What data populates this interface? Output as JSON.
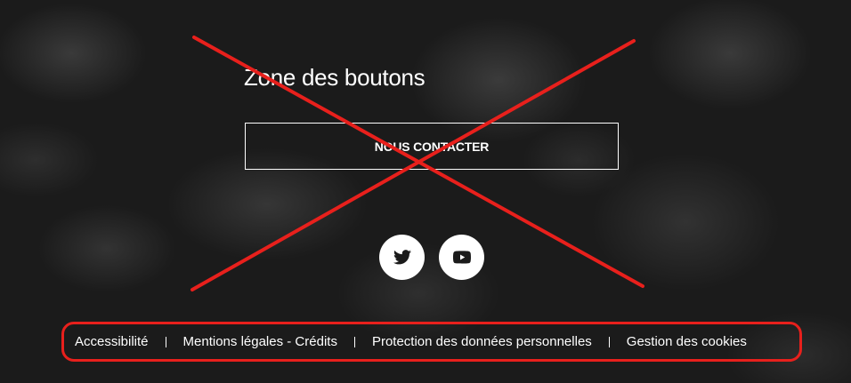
{
  "section": {
    "title": "Zone des boutons"
  },
  "cta": {
    "label": "NOUS CONTACTER"
  },
  "social": [
    {
      "icon": "twitter-icon"
    },
    {
      "icon": "youtube-icon"
    }
  ],
  "footer": {
    "links": [
      "Accessibilité",
      "Mentions légales - Crédits",
      "Protection des données personnelles",
      "Gestion des cookies"
    ]
  },
  "colors": {
    "annotation": "#e8201c",
    "background": "#1d1d1d",
    "text": "#ffffff"
  }
}
